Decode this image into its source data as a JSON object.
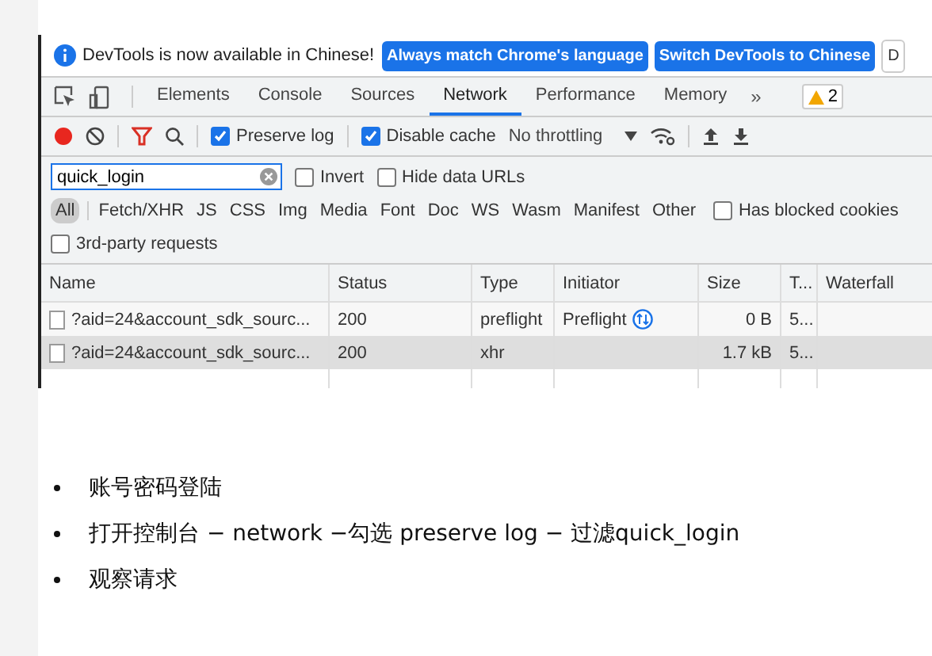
{
  "banner": {
    "message": "DevTools is now available in Chinese!",
    "buttons": [
      "Always match Chrome's language",
      "Switch DevTools to Chinese",
      "D"
    ]
  },
  "tabs": [
    {
      "label": "Elements",
      "selected": false
    },
    {
      "label": "Console",
      "selected": false
    },
    {
      "label": "Sources",
      "selected": false
    },
    {
      "label": "Network",
      "selected": true
    },
    {
      "label": "Performance",
      "selected": false
    },
    {
      "label": "Memory",
      "selected": false
    }
  ],
  "more_tabs": "»",
  "warnings": "2",
  "toolbar": {
    "recording": true,
    "filter_active": true,
    "preserve_log": {
      "label": "Preserve log",
      "checked": true
    },
    "disable_cache": {
      "label": "Disable cache",
      "checked": true
    },
    "throttling": "No throttling"
  },
  "filter": {
    "value": "quick_login",
    "invert": {
      "label": "Invert",
      "checked": false
    },
    "hide_data_urls": {
      "label": "Hide data URLs",
      "checked": false
    }
  },
  "types": [
    {
      "label": "All",
      "selected": true
    },
    {
      "label": "Fetch/XHR",
      "selected": false
    },
    {
      "label": "JS",
      "selected": false
    },
    {
      "label": "CSS",
      "selected": false
    },
    {
      "label": "Img",
      "selected": false
    },
    {
      "label": "Media",
      "selected": false
    },
    {
      "label": "Font",
      "selected": false
    },
    {
      "label": "Doc",
      "selected": false
    },
    {
      "label": "WS",
      "selected": false
    },
    {
      "label": "Wasm",
      "selected": false
    },
    {
      "label": "Manifest",
      "selected": false
    },
    {
      "label": "Other",
      "selected": false
    }
  ],
  "has_blocked_cookies": {
    "label": "Has blocked cookies",
    "checked": false
  },
  "third_party": {
    "label": "3rd-party requests",
    "checked": false
  },
  "table": {
    "columns": [
      "Name",
      "Status",
      "Type",
      "Initiator",
      "Size",
      "T...",
      "Waterfall"
    ],
    "rows": [
      {
        "name": "?aid=24&account_sdk_sourc...",
        "status": "200",
        "type": "preflight",
        "initiator": "Preflight",
        "initiator_icon": true,
        "size": "0 B",
        "time": "5...",
        "selected": false
      },
      {
        "name": "?aid=24&account_sdk_sourc...",
        "status": "200",
        "type": "xhr",
        "initiator": "",
        "initiator_icon": false,
        "size": "1.7 kB",
        "time": "5...",
        "selected": true
      }
    ]
  },
  "bullets": [
    "账号密码登陆",
    "打开控制台 − network −勾选 preserve log − 过滤quick_login",
    "观察请求"
  ]
}
